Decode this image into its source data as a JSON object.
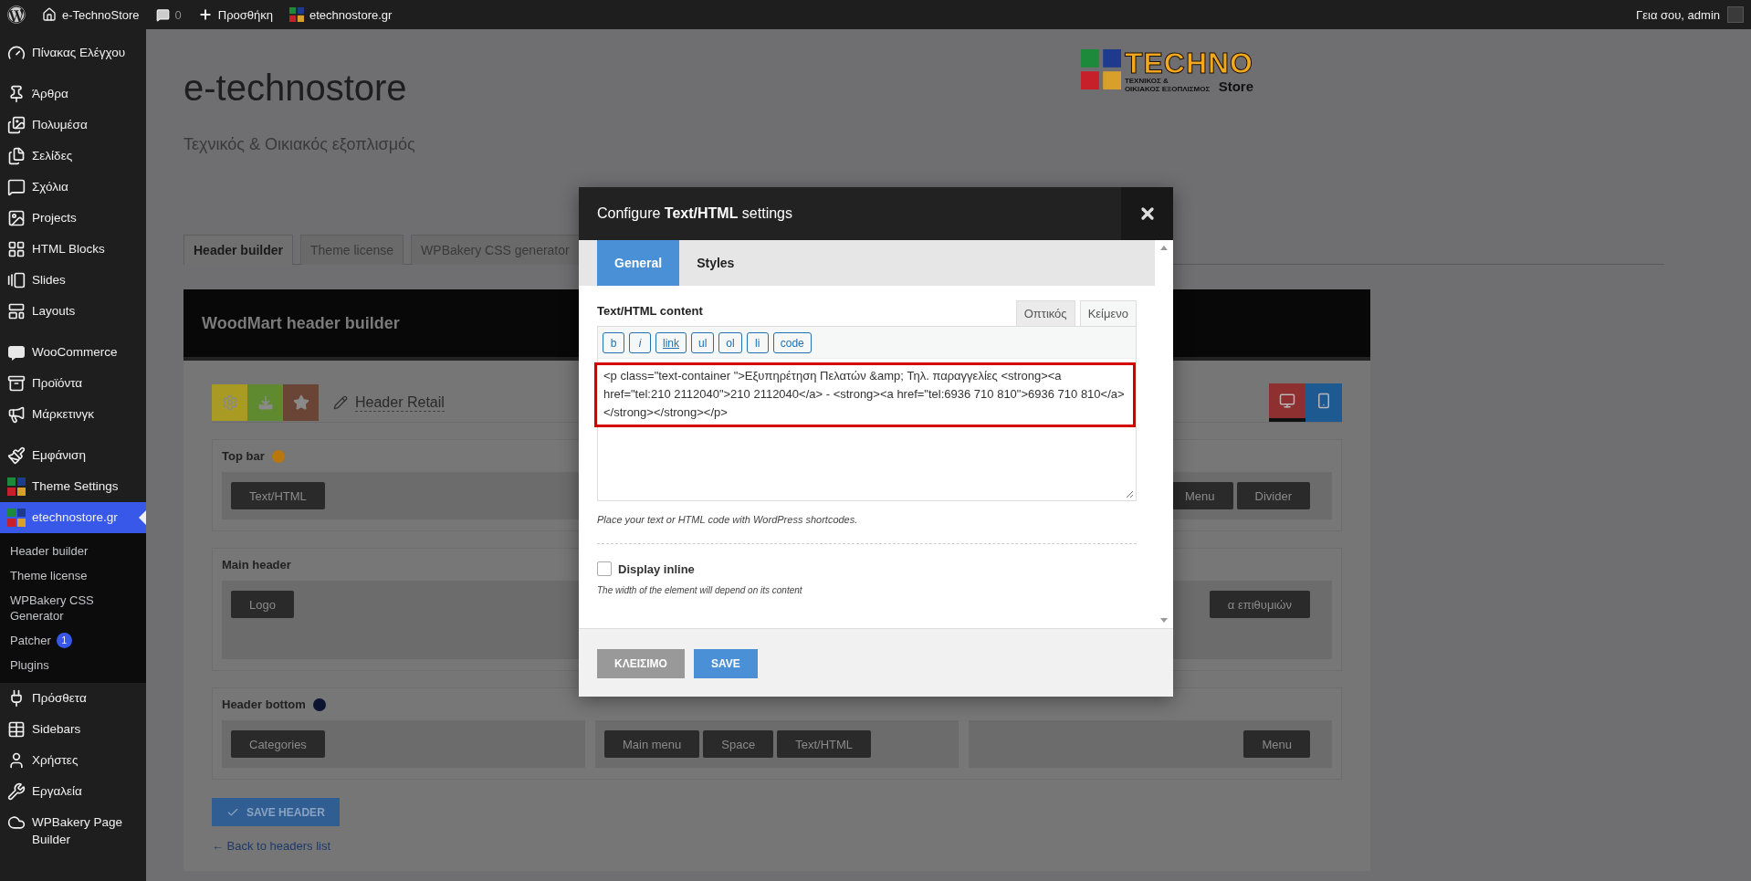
{
  "admin_bar": {
    "site": "e-TechnoStore",
    "comments": "0",
    "new_label": "Προσθήκη",
    "site_link": "etechnostore.gr",
    "greeting": "Γεια σου, admin"
  },
  "sidebar": {
    "groups": [
      {
        "items": [
          {
            "label": "Πίνακας Ελέγχου",
            "selected": false
          }
        ]
      },
      {
        "items": [
          {
            "label": "Άρθρα",
            "selected": false
          },
          {
            "label": "Πολυμέσα",
            "selected": false
          },
          {
            "label": "Σελίδες",
            "selected": false
          },
          {
            "label": "Σχόλια",
            "selected": false
          },
          {
            "label": "Projects",
            "selected": false
          },
          {
            "label": "HTML Blocks",
            "selected": false
          },
          {
            "label": "Slides",
            "selected": false
          },
          {
            "label": "Layouts",
            "selected": false
          }
        ]
      },
      {
        "items": [
          {
            "label": "WooCommerce",
            "selected": false
          },
          {
            "label": "Προϊόντα",
            "selected": false
          },
          {
            "label": "Μάρκετινγκ",
            "selected": false
          }
        ]
      },
      {
        "items": [
          {
            "label": "Εμφάνιση",
            "selected": false
          },
          {
            "label": "Theme Settings",
            "selected": false
          },
          {
            "label": "etechnostore.gr",
            "selected": true,
            "children": [
              {
                "label": "Header builder"
              },
              {
                "label": "Theme license"
              },
              {
                "label": "WPBakery CSS Generator"
              },
              {
                "label": "Patcher",
                "badge": "1"
              },
              {
                "label": "Plugins"
              }
            ]
          },
          {
            "label": "Πρόσθετα",
            "selected": false
          },
          {
            "label": "Sidebars",
            "selected": false
          },
          {
            "label": "Χρήστες",
            "selected": false
          },
          {
            "label": "Εργαλεία",
            "selected": false
          },
          {
            "label": "WPBakery Page Builder",
            "selected": false
          }
        ]
      }
    ]
  },
  "page": {
    "title": "e-technostore",
    "tagline": "Τεχνικός & Οικιακός εξοπλισμός",
    "logo": {
      "word": "TECHNO",
      "sub": "Store",
      "lines": [
        "ΤΕΧΝΙΚΟΣ &",
        "ΟΙΚΙΑΚΟΣ ΕΞΟΠΛΙΣΜΟΣ"
      ]
    },
    "tabs": [
      {
        "label": "Header builder",
        "selected": true
      },
      {
        "label": "Theme license",
        "selected": false
      },
      {
        "label": "WPBakery CSS generator",
        "selected": false
      }
    ],
    "builder": {
      "title": "WoodMart header builder",
      "header_name": "Header Retail",
      "devices": [
        {
          "kind": "desktop",
          "selected": true
        },
        {
          "kind": "mobile",
          "selected": false
        }
      ],
      "rows": [
        {
          "title": "Top bar",
          "color": "#b8780f",
          "columns": [
            [
              "Text/HTML"
            ],
            [],
            [
              "Menu",
              "Divider"
            ]
          ]
        },
        {
          "title": "Main header",
          "columns": [
            [
              "Logo"
            ],
            [],
            [
              "α επιθυμιών"
            ]
          ]
        },
        {
          "title": "Header bottom",
          "color": "#0b1530",
          "columns": [
            [
              "Categories"
            ],
            [
              "Main menu",
              "Space",
              "Text/HTML"
            ],
            [
              "Menu"
            ]
          ]
        }
      ]
    },
    "save_button": "SAVE HEADER",
    "back_link": "← Back to headers list"
  },
  "modal": {
    "title": "Configure **Text/HTML** settings",
    "tabs": [
      {
        "label": "General",
        "selected": true
      },
      {
        "label": "Styles",
        "selected": false
      }
    ],
    "field_label": "Text/HTML content",
    "editor_tabs": [
      {
        "label": "Οπτικός",
        "selected": false
      },
      {
        "label": "Κείμενο",
        "selected": true
      }
    ],
    "toolbar": [
      {
        "label": "b",
        "kind": "plain"
      },
      {
        "label": "i",
        "kind": "italic"
      },
      {
        "label": "link",
        "kind": "underline"
      },
      {
        "label": "ul",
        "kind": "plain"
      },
      {
        "label": "ol",
        "kind": "plain"
      },
      {
        "label": "li",
        "kind": "plain"
      },
      {
        "label": "code",
        "kind": "plain"
      }
    ],
    "content": "<p class=\"text-container \">Εξυπηρέτηση Πελατών &amp; Τηλ. παραγγελίες <strong><a href=\"tel:210 2112040\">210 2112040</a> - <strong><a href=\"tel:6936 710 810\">6936 710 810</a></strong></strong></p>",
    "hint": "Place your text or HTML code with WordPress shortcodes.",
    "checkbox": {
      "label": "Display inline",
      "checked": false
    },
    "checkbox_hint": "The width of the element will depend on its content",
    "buttons": [
      {
        "label": "ΚΛΕΙΣΙΜΟ",
        "kind": "secondary"
      },
      {
        "label": "SAVE",
        "kind": "primary"
      }
    ]
  }
}
